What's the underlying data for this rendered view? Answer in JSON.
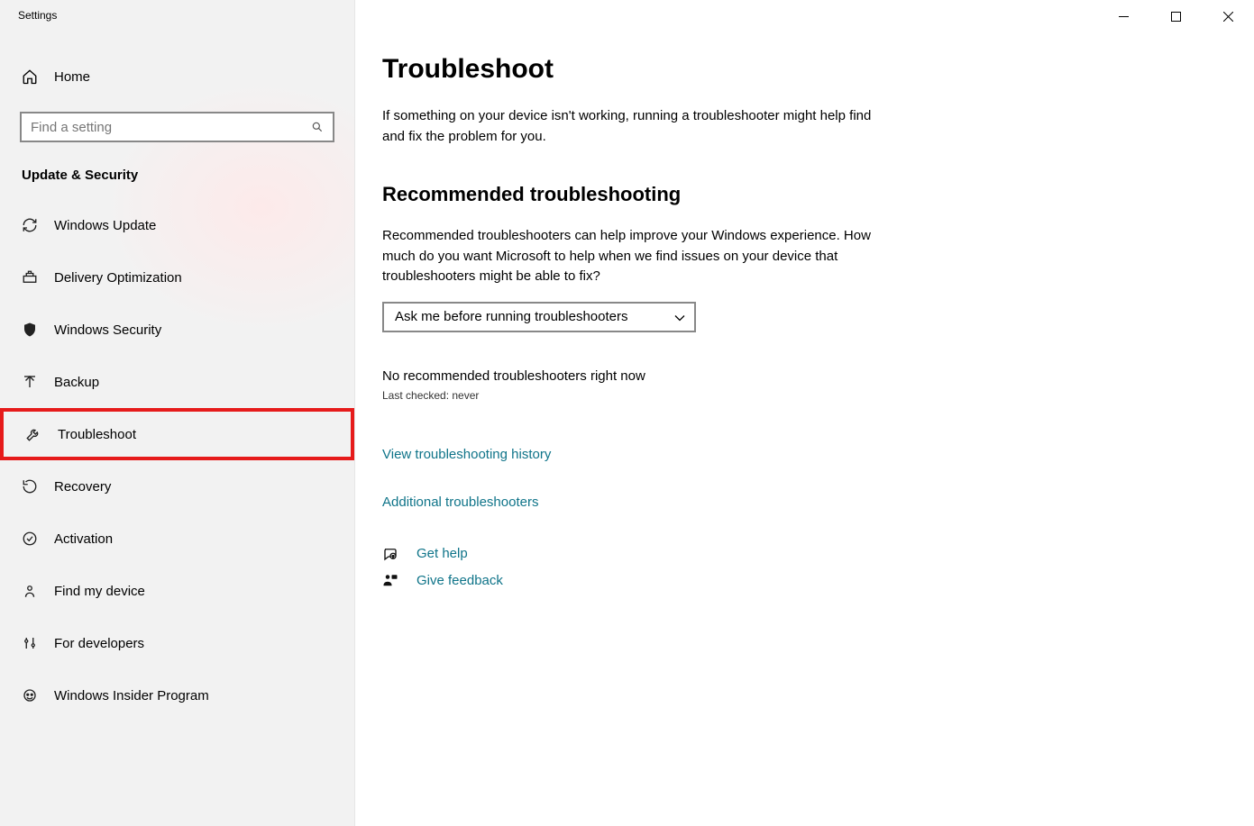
{
  "window": {
    "title": "Settings"
  },
  "sidebar": {
    "home_label": "Home",
    "search_placeholder": "Find a setting",
    "section_title": "Update & Security",
    "items": [
      {
        "label": "Windows Update"
      },
      {
        "label": "Delivery Optimization"
      },
      {
        "label": "Windows Security"
      },
      {
        "label": "Backup"
      },
      {
        "label": "Troubleshoot"
      },
      {
        "label": "Recovery"
      },
      {
        "label": "Activation"
      },
      {
        "label": "Find my device"
      },
      {
        "label": "For developers"
      },
      {
        "label": "Windows Insider Program"
      }
    ]
  },
  "main": {
    "title": "Troubleshoot",
    "lead": "If something on your device isn't working, running a troubleshooter might help find and fix the problem for you.",
    "section_heading": "Recommended troubleshooting",
    "rec_desc": "Recommended troubleshooters can help improve your Windows experience. How much do you want Microsoft to help when we find issues on your device that troubleshooters might be able to fix?",
    "dropdown_value": "Ask me before running troubleshooters",
    "status": "No recommended troubleshooters right now",
    "last_checked": "Last checked: never",
    "link_history": "View troubleshooting history",
    "link_additional": "Additional troubleshooters",
    "link_get_help": "Get help",
    "link_give_feedback": "Give feedback"
  }
}
